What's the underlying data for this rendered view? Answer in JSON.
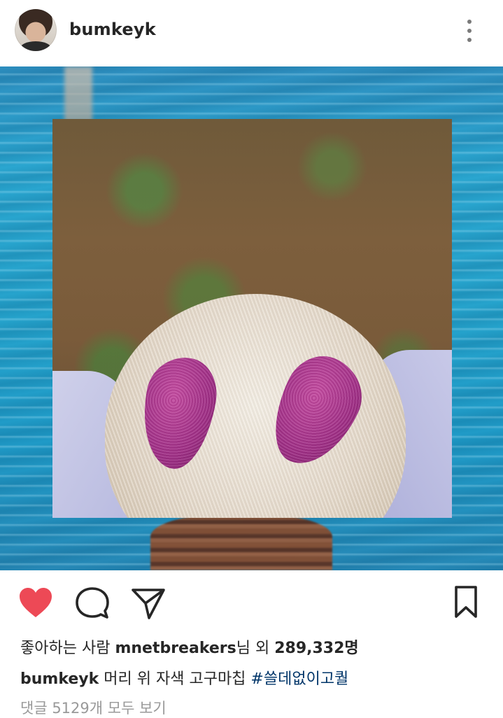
{
  "post": {
    "username": "bumkeyk",
    "likes": {
      "prefix": "좋아하는 사람",
      "liked_by": "mnetbreakers",
      "middle": "님 외",
      "count": "289,332명"
    },
    "caption": {
      "username": "bumkeyk",
      "text": "머리 위 자색 고구마칩",
      "hashtag": "#쓸데없이고퀄"
    },
    "view_comments": "댓글 5129개 모두 보기",
    "liked": true
  },
  "colors": {
    "like_red": "#ed4956",
    "hashtag_blue": "#003569",
    "muted_gray": "#999999",
    "text": "#262626"
  },
  "icons": {
    "like": "heart-icon",
    "comment": "comment-bubble-icon",
    "share": "paper-plane-icon",
    "save": "bookmark-icon",
    "more": "vertical-ellipsis-icon"
  }
}
